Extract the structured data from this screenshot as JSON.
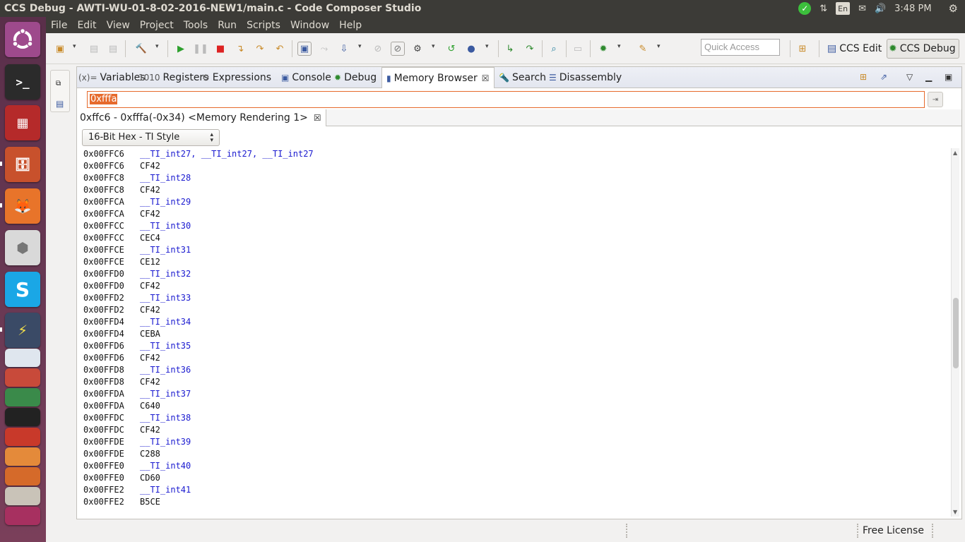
{
  "window": {
    "title": "CCS Debug - AWTI-WU-01-8-02-2016-NEW1/main.c - Code Composer Studio"
  },
  "panel": {
    "language": "En",
    "time": "3:48 PM"
  },
  "menu": [
    "File",
    "Edit",
    "View",
    "Project",
    "Tools",
    "Run",
    "Scripts",
    "Window",
    "Help"
  ],
  "toolbar": {
    "quick_access_placeholder": "Quick Access",
    "perspectives": [
      "CCS Edit",
      "CCS Debug"
    ],
    "active_perspective": "CCS Debug"
  },
  "tabs": [
    {
      "label": "Variables",
      "icon": "variables-icon"
    },
    {
      "label": "Registers",
      "icon": "registers-icon"
    },
    {
      "label": "Expressions",
      "icon": "expressions-icon"
    },
    {
      "label": "Console",
      "icon": "console-icon"
    },
    {
      "label": "Debug",
      "icon": "debug-icon"
    },
    {
      "label": "Memory Browser",
      "icon": "memory-icon",
      "active": true
    },
    {
      "label": "Search",
      "icon": "search-icon"
    },
    {
      "label": "Disassembly",
      "icon": "disassembly-icon"
    }
  ],
  "memory": {
    "address_input": "0xfffa",
    "rendering_tab": "0xffc6 - 0xfffa(-0x34) <Memory Rendering 1>",
    "format": "16-Bit Hex - TI Style",
    "rows": [
      {
        "address": "0x00FFC6",
        "value": "__TI_int27, __TI_int27, __TI_int27",
        "is_label": true
      },
      {
        "address": "0x00FFC6",
        "value": "CF42",
        "is_label": false
      },
      {
        "address": "0x00FFC8",
        "value": "__TI_int28",
        "is_label": true
      },
      {
        "address": "0x00FFC8",
        "value": "CF42",
        "is_label": false
      },
      {
        "address": "0x00FFCA",
        "value": "__TI_int29",
        "is_label": true
      },
      {
        "address": "0x00FFCA",
        "value": "CF42",
        "is_label": false
      },
      {
        "address": "0x00FFCC",
        "value": "__TI_int30",
        "is_label": true
      },
      {
        "address": "0x00FFCC",
        "value": "CEC4",
        "is_label": false
      },
      {
        "address": "0x00FFCE",
        "value": "__TI_int31",
        "is_label": true
      },
      {
        "address": "0x00FFCE",
        "value": "CE12",
        "is_label": false
      },
      {
        "address": "0x00FFD0",
        "value": "__TI_int32",
        "is_label": true
      },
      {
        "address": "0x00FFD0",
        "value": "CF42",
        "is_label": false
      },
      {
        "address": "0x00FFD2",
        "value": "__TI_int33",
        "is_label": true
      },
      {
        "address": "0x00FFD2",
        "value": "CF42",
        "is_label": false
      },
      {
        "address": "0x00FFD4",
        "value": "__TI_int34",
        "is_label": true
      },
      {
        "address": "0x00FFD4",
        "value": "CEBA",
        "is_label": false
      },
      {
        "address": "0x00FFD6",
        "value": "__TI_int35",
        "is_label": true
      },
      {
        "address": "0x00FFD6",
        "value": "CF42",
        "is_label": false
      },
      {
        "address": "0x00FFD8",
        "value": "__TI_int36",
        "is_label": true
      },
      {
        "address": "0x00FFD8",
        "value": "CF42",
        "is_label": false
      },
      {
        "address": "0x00FFDA",
        "value": "__TI_int37",
        "is_label": true
      },
      {
        "address": "0x00FFDA",
        "value": "C640",
        "is_label": false
      },
      {
        "address": "0x00FFDC",
        "value": "__TI_int38",
        "is_label": true
      },
      {
        "address": "0x00FFDC",
        "value": "CF42",
        "is_label": false
      },
      {
        "address": "0x00FFDE",
        "value": "__TI_int39",
        "is_label": true
      },
      {
        "address": "0x00FFDE",
        "value": "C288",
        "is_label": false
      },
      {
        "address": "0x00FFE0",
        "value": "__TI_int40",
        "is_label": true
      },
      {
        "address": "0x00FFE0",
        "value": "CD60",
        "is_label": false
      },
      {
        "address": "0x00FFE2",
        "value": "__TI_int41",
        "is_label": true
      },
      {
        "address": "0x00FFE2",
        "value": "B5CE",
        "is_label": false
      }
    ]
  },
  "status": {
    "license": "Free License"
  },
  "colors": {
    "label_blue": "#1a1ad0",
    "address_highlight": "#e66a2c",
    "panel_dark": "#3c3b37"
  }
}
